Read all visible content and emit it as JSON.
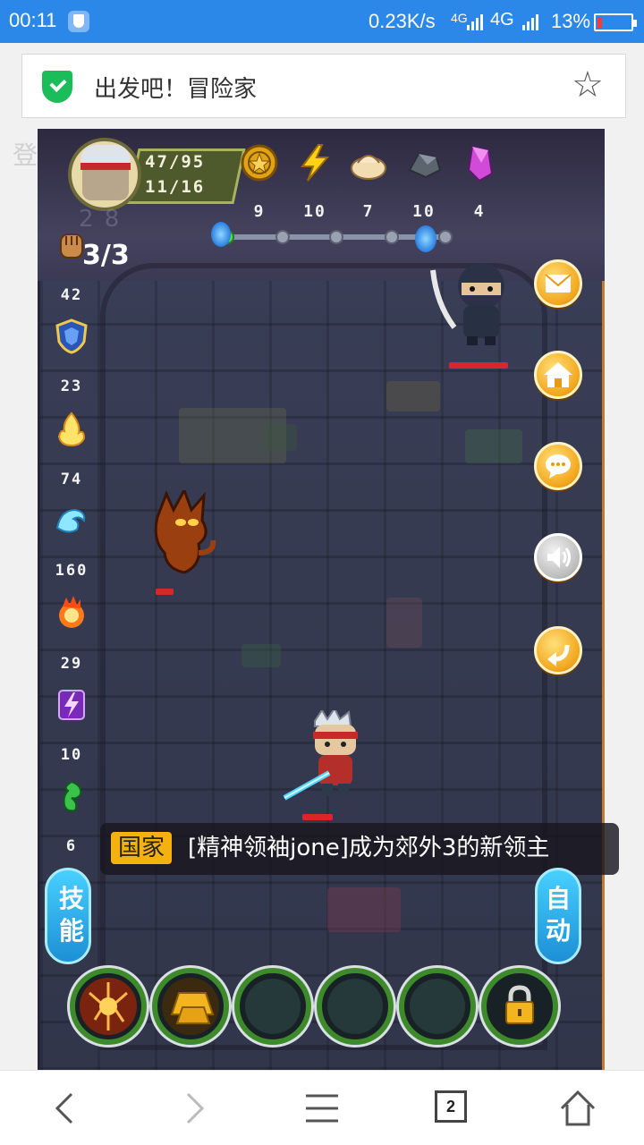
{
  "status_bar": {
    "time": "00:11",
    "speed": "0.23K/s",
    "net_label_1": "4G",
    "net_label_2": "4G",
    "battery": "13%",
    "battery_level": 0.13,
    "battery_color": "#ff3b30"
  },
  "browser": {
    "page_title": "出发吧！冒险家",
    "secure_icon": "shield-check-icon",
    "bookmark_icon": "star-outline-icon"
  },
  "game": {
    "left_ghost_char": "登",
    "player": {
      "hp": "47/95",
      "level": "11/16"
    },
    "resources": [
      {
        "name": "gold-coin-icon",
        "value": "9"
      },
      {
        "name": "lightning-icon",
        "value": "10"
      },
      {
        "name": "dumpling-icon",
        "value": "7"
      },
      {
        "name": "iron-ore-icon",
        "value": "10"
      },
      {
        "name": "crystal-icon",
        "value": "4"
      }
    ],
    "fist_count": "3/3",
    "left_stats": [
      {
        "name": "fist-icon",
        "value": "42"
      },
      {
        "name": "shield-icon",
        "value": "23"
      },
      {
        "name": "fire-spirit-icon",
        "value": "74"
      },
      {
        "name": "water-wave-icon",
        "value": "160"
      },
      {
        "name": "fireball-icon",
        "value": "29"
      },
      {
        "name": "lightning-rune-icon",
        "value": "10"
      },
      {
        "name": "poison-icon",
        "value": "6"
      }
    ],
    "right_buttons": [
      "mail-icon",
      "home-icon",
      "chat-icon",
      "sound-icon",
      "back-icon"
    ],
    "notice": {
      "tag": "国家",
      "message": "[精神领袖jone]成为郊外3的新领主"
    },
    "skill_button": "技能",
    "auto_button": "自动",
    "skill_slots": [
      "fire-rune-skill",
      "gold-ingot-skill",
      "empty-slot",
      "empty-slot",
      "empty-slot",
      "locked-slot"
    ]
  },
  "bottom_nav": {
    "tab_count": "2"
  }
}
